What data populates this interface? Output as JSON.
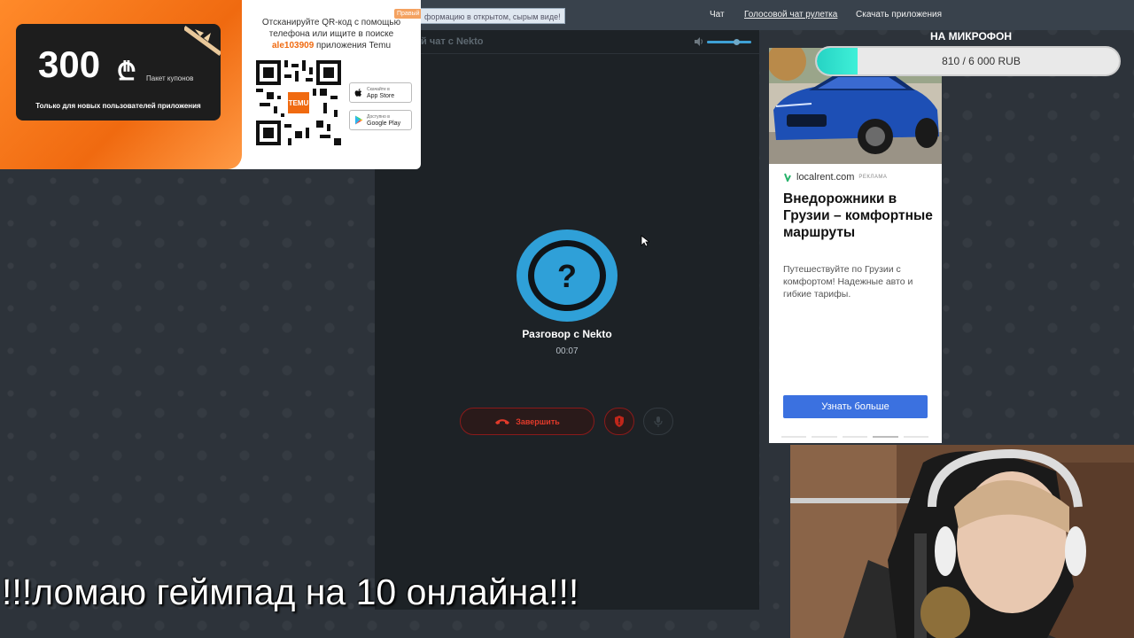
{
  "nav": {
    "notice": "формацию в открытом, сырым виде!",
    "links": [
      "Чат",
      "Голосовой чат рулетка",
      "Скачать приложения"
    ]
  },
  "chat": {
    "header_title": "й чат с Nekto",
    "conversation_title": "Разговор с Nekto",
    "timer": "00:07",
    "end_label": "Завершить",
    "accent_color": "#3ea1d6",
    "danger_color": "#e23a2a"
  },
  "temu_ad": {
    "amount": "300",
    "currency": "₾",
    "package_label": "Пакет купонов",
    "note": "Только для новых пользователей приложения",
    "badge": "Правый",
    "line1": "Отсканируйте QR-код с помощью",
    "line2": "телефона или ищите в поиске",
    "code": "ale103909",
    "line3": " приложения Temu",
    "app_store_small": "Скачайте в",
    "app_store": "App Store",
    "google_play_small": "Доступно в",
    "google_play": "Google Play",
    "brand_color": "#f06a10"
  },
  "right_ad": {
    "domain": "localrent.com",
    "tag": "РЕКЛАМА",
    "title": "Внедорожники в Грузии – комфортные маршруты",
    "description": "Путешествуйте по Грузии с комфортом! Надежные авто и гибкие тарифы.",
    "cta": "Узнать больше",
    "cta_color": "#3b71e0"
  },
  "donation": {
    "title": "НА МИКРОФОН",
    "progress_text": "810 / 6 000 RUB",
    "progress_fraction": 0.135
  },
  "caption": "!!!ломаю геймпад на 10 онлайна!!!"
}
